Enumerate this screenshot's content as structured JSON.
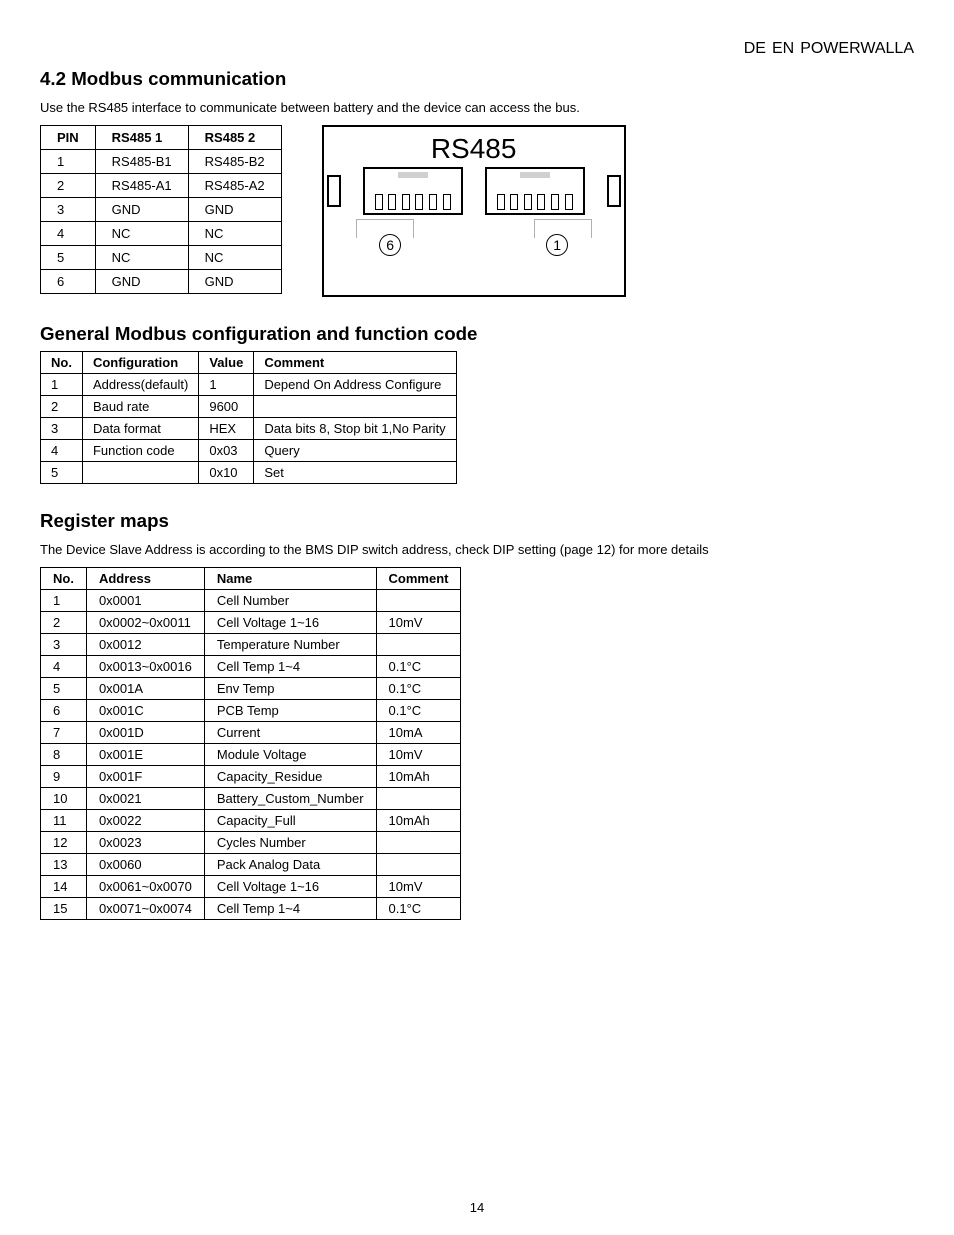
{
  "header": {
    "lang_de": "DE",
    "lang_en": "EN",
    "product": "POWERWALLA"
  },
  "section_modbus": {
    "title": "4.2 Modbus communication",
    "intro": "Use the RS485 interface to communicate between battery and the device can access the bus."
  },
  "pin_table": {
    "headers": [
      "PIN",
      "RS485 1",
      "RS485 2"
    ],
    "rows": [
      [
        "1",
        "RS485-B1",
        "RS485-B2"
      ],
      [
        "2",
        "RS485-A1",
        "RS485-A2"
      ],
      [
        "3",
        "GND",
        "GND"
      ],
      [
        "4",
        "NC",
        "NC"
      ],
      [
        "5",
        "NC",
        "NC"
      ],
      [
        "6",
        "GND",
        "GND"
      ]
    ]
  },
  "connector": {
    "label": "RS485",
    "pin_left": "6",
    "pin_right": "1"
  },
  "cfg_heading": "General Modbus configuration and function code",
  "cfg_table": {
    "headers": [
      "No.",
      "Configuration",
      "Value",
      "Comment"
    ],
    "rows": [
      [
        "1",
        "Address(default)",
        "1",
        "Depend On Address Configure"
      ],
      [
        "2",
        "Baud rate",
        "9600",
        ""
      ],
      [
        "3",
        "Data format",
        "HEX",
        "Data bits 8, Stop bit 1,No Parity"
      ],
      [
        "4",
        "Function code",
        "0x03",
        "Query"
      ],
      [
        "5",
        "",
        "0x10",
        "Set"
      ]
    ]
  },
  "maps_heading": "Register maps",
  "note_text": "The Device Slave Address is according to the BMS DIP switch address, check DIP setting (page 12) for more details",
  "map_table": {
    "headers": [
      "No.",
      "Address",
      "Name",
      "Comment"
    ],
    "rows": [
      [
        "1",
        "0x0001",
        "Cell Number",
        ""
      ],
      [
        "2",
        "0x0002~0x0011",
        "Cell Voltage 1~16",
        "10mV"
      ],
      [
        "3",
        "0x0012",
        "Temperature Number",
        ""
      ],
      [
        "4",
        "0x0013~0x0016",
        "Cell Temp 1~4",
        "0.1°C"
      ],
      [
        "5",
        "0x001A",
        "Env Temp",
        "0.1°C"
      ],
      [
        "6",
        "0x001C",
        "PCB Temp",
        "0.1°C"
      ],
      [
        "7",
        "0x001D",
        "Current",
        "10mA"
      ],
      [
        "8",
        "0x001E",
        "Module Voltage",
        "10mV"
      ],
      [
        "9",
        "0x001F",
        "Capacity_Residue",
        "10mAh"
      ],
      [
        "10",
        "0x0021",
        "Battery_Custom_Number",
        ""
      ],
      [
        "11",
        "0x0022",
        "Capacity_Full",
        "10mAh"
      ],
      [
        "12",
        "0x0023",
        "Cycles Number",
        ""
      ],
      [
        "13",
        "0x0060",
        "Pack Analog Data",
        ""
      ],
      [
        "14",
        "0x0061~0x0070",
        "Cell Voltage 1~16",
        "10mV"
      ],
      [
        "15",
        "0x0071~0x0074",
        "Cell Temp 1~4",
        "0.1°C"
      ]
    ]
  },
  "footer": {
    "page_number": "14"
  }
}
